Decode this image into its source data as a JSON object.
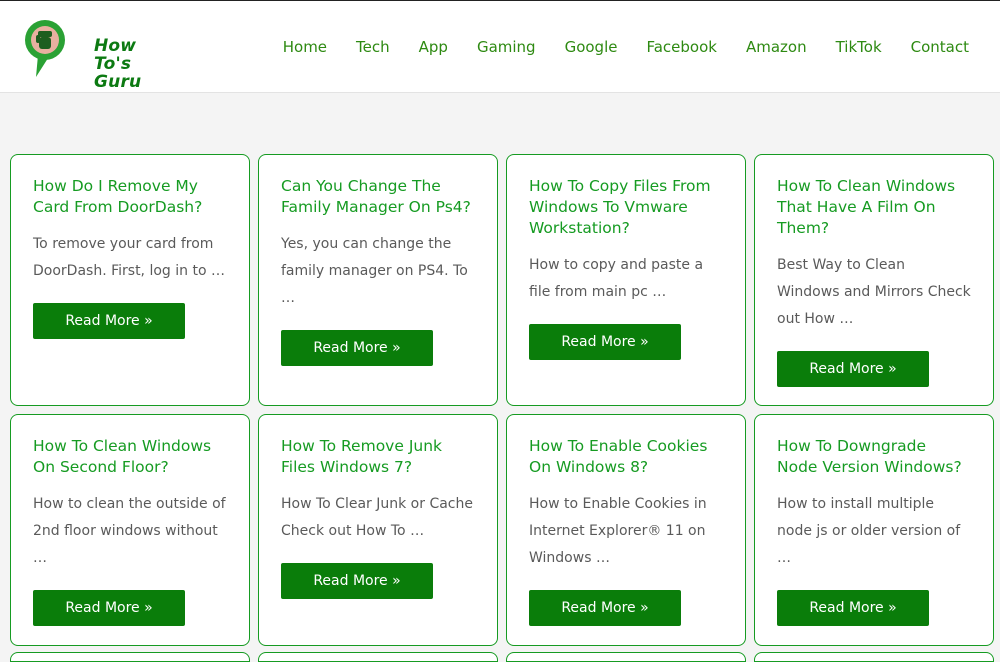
{
  "brand": {
    "line1": "How To's",
    "line2": "Guru",
    "color": "#0c7a12",
    "accent": "#2aa134",
    "fist": "#e8b0a0"
  },
  "nav": [
    "Home",
    "Tech",
    "App",
    "Gaming",
    "Google",
    "Facebook",
    "Amazon",
    "TikTok",
    "Contact"
  ],
  "cards": [
    {
      "title": "How Do I Remove My Card From DoorDash?",
      "excerpt": "To remove your card from DoorDash. First, log in to …",
      "button": "Read More »"
    },
    {
      "title": "Can You Change The Family Manager On Ps4?",
      "excerpt": "Yes, you can change the family manager on PS4. To …",
      "button": "Read More »"
    },
    {
      "title": "How To Copy Files From Windows To Vmware Workstation?",
      "excerpt": "How to copy and paste a file from main pc …",
      "button": "Read More »"
    },
    {
      "title": "How To Clean Windows That Have A Film On Them?",
      "excerpt": "Best Way to Clean Windows and Mirrors Check out How …",
      "button": "Read More »"
    },
    {
      "title": "How To Clean Windows On Second Floor?",
      "excerpt": "How to clean the outside of 2nd floor windows without …",
      "button": "Read More »"
    },
    {
      "title": "How To Remove Junk Files Windows 7?",
      "excerpt": "How To Clear Junk or Cache Check out How To …",
      "button": "Read More »"
    },
    {
      "title": "How To Enable Cookies On Windows 8?",
      "excerpt": "How to Enable Cookies in Internet Explorer® 11 on Windows …",
      "button": "Read More »"
    },
    {
      "title": "How To Downgrade Node Version Windows?",
      "excerpt": "How to install multiple node js or older version of …",
      "button": "Read More »"
    }
  ],
  "colors": {
    "card_border": "#169b22",
    "button_bg": "#0a7d0a",
    "nav_text": "#2e8a12"
  }
}
